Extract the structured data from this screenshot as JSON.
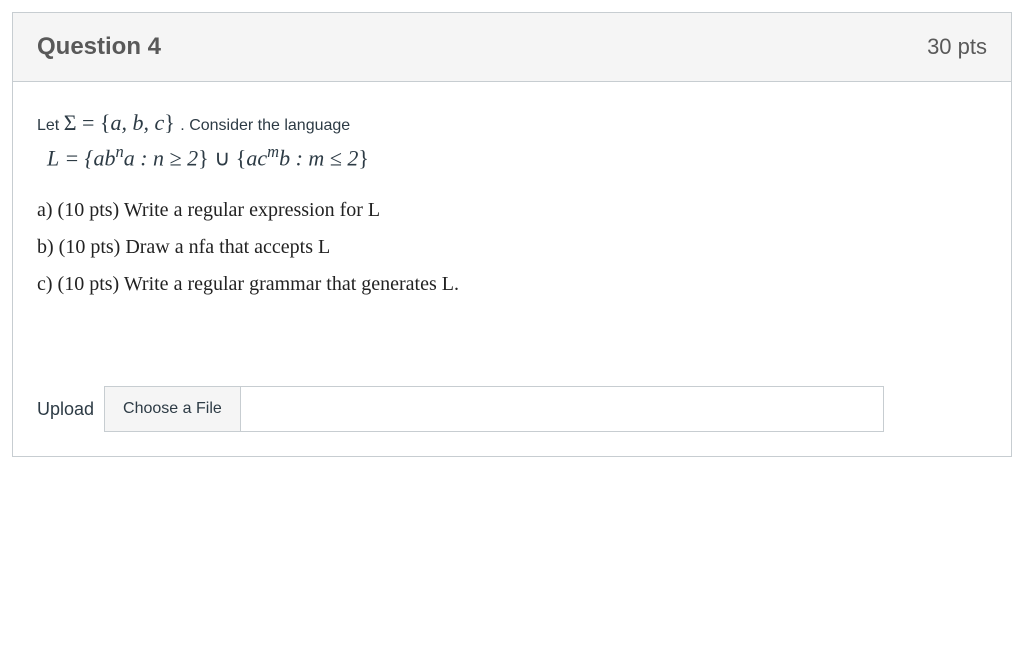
{
  "header": {
    "title": "Question 4",
    "points": "30 pts"
  },
  "intro": {
    "let_text": "Let ",
    "sigma_expr_prefix": "Σ = {",
    "sigma_expr_items": "a, b, c",
    "sigma_expr_suffix": "}",
    "consider": ". Consider the language"
  },
  "language_def": {
    "prefix": "L = {",
    "part1_ab": "ab",
    "part1_exp": "n",
    "part1_a": "a : n ≥ 2",
    "mid": "} ∪ {",
    "part2_ac": "ac",
    "part2_exp": "m",
    "part2_b": "b : m ≤ 2",
    "suffix": "}"
  },
  "parts": {
    "a": "a) (10 pts) Write a regular expression for L",
    "b": "b) (10 pts) Draw a nfa that accepts L",
    "c": "c) (10 pts) Write a regular grammar that generates L."
  },
  "upload": {
    "label": "Upload",
    "button": "Choose a File"
  }
}
